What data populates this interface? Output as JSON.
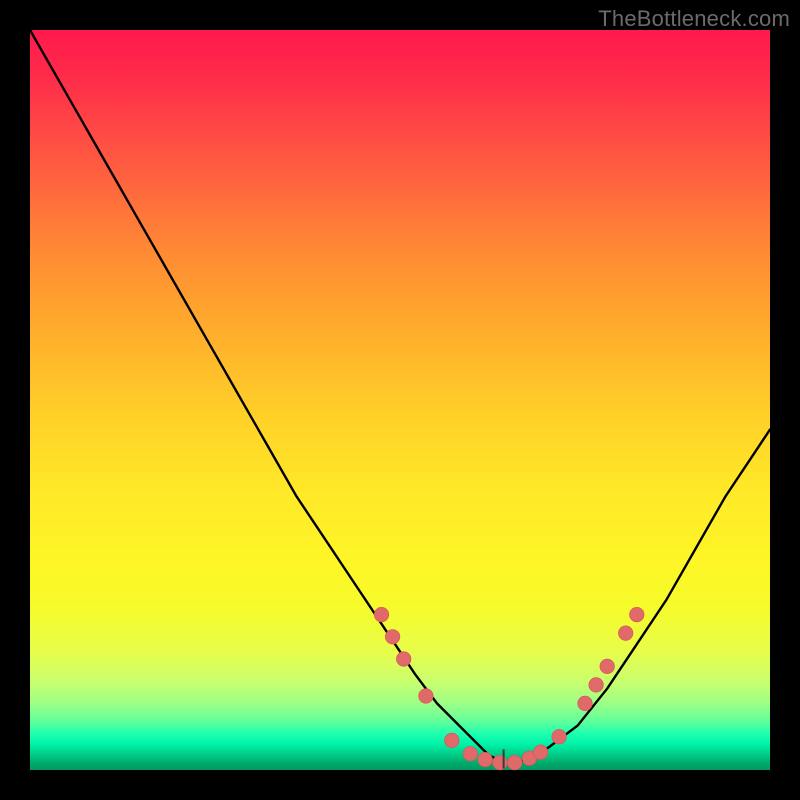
{
  "watermark": "TheBottleneck.com",
  "colors": {
    "background": "#000000",
    "curve": "#000000",
    "marker_fill": "#e06a6a",
    "marker_stroke": "#d85a5a",
    "gradient_top": "#ff1a4d",
    "gradient_bottom": "#009a60"
  },
  "chart_data": {
    "type": "line",
    "title": "",
    "xlabel": "",
    "ylabel": "",
    "xlim": [
      0,
      100
    ],
    "ylim": [
      0,
      100
    ],
    "notes": "Bottleneck-style V-curve. y≈0 at the minimum around x≈64; left arm rises steeply to y≈100 at x≈0; right arm rises to y≈46 at x≈100. Pink markers cluster near the minimum on both arms.",
    "series": [
      {
        "name": "curve",
        "x": [
          0,
          4,
          8,
          12,
          16,
          20,
          24,
          28,
          32,
          36,
          40,
          44,
          48,
          52,
          55,
          58,
          60,
          62,
          64,
          66,
          68,
          70,
          74,
          78,
          82,
          86,
          90,
          94,
          98,
          100
        ],
        "y": [
          100,
          93,
          86,
          79,
          72,
          65,
          58,
          51,
          44,
          37,
          31,
          25,
          19,
          13,
          9,
          6,
          4,
          2,
          1,
          1,
          2,
          3,
          6,
          11,
          17,
          23,
          30,
          37,
          43,
          46
        ]
      }
    ],
    "markers": [
      {
        "x": 47.5,
        "y": 21
      },
      {
        "x": 49.0,
        "y": 18
      },
      {
        "x": 50.5,
        "y": 15
      },
      {
        "x": 53.5,
        "y": 10
      },
      {
        "x": 57.0,
        "y": 4
      },
      {
        "x": 59.5,
        "y": 2.2
      },
      {
        "x": 61.5,
        "y": 1.4
      },
      {
        "x": 63.5,
        "y": 1.0
      },
      {
        "x": 65.5,
        "y": 1.0
      },
      {
        "x": 67.5,
        "y": 1.6
      },
      {
        "x": 69.0,
        "y": 2.4
      },
      {
        "x": 71.5,
        "y": 4.5
      },
      {
        "x": 75.0,
        "y": 9.0
      },
      {
        "x": 76.5,
        "y": 11.5
      },
      {
        "x": 78.0,
        "y": 14.0
      },
      {
        "x": 80.5,
        "y": 18.5
      },
      {
        "x": 82.0,
        "y": 21.0
      }
    ]
  }
}
